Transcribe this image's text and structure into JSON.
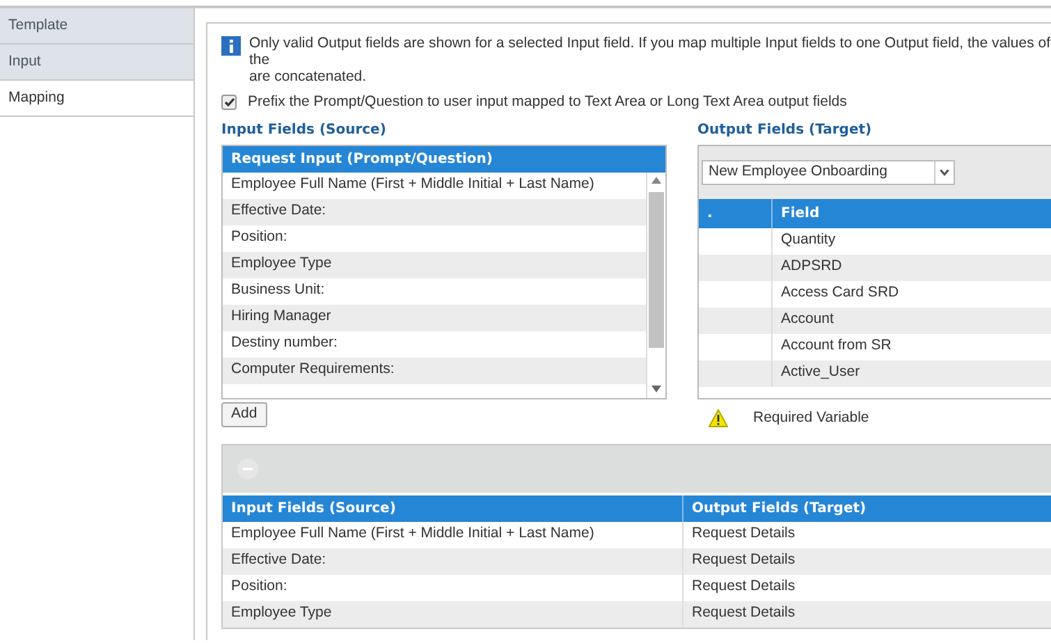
{
  "sidebar": {
    "items": [
      {
        "label": "Template",
        "selected": false
      },
      {
        "label": "Input",
        "selected": false
      },
      {
        "label": "Mapping",
        "selected": true
      }
    ]
  },
  "info": {
    "lines": [
      "Only valid Output fields are shown for a selected Input field. If you map multiple Input fields to one Output field, the values of the",
      "are concatenated."
    ]
  },
  "prefix_option": {
    "label": "Prefix the Prompt/Question to user input mapped to Text Area or Long Text Area output fields",
    "checked": true
  },
  "input_fields": {
    "title": "Input Fields (Source)",
    "column": "Request Input (Prompt/Question)",
    "rows": [
      "Employee Full Name (First + Middle Initial + Last Name)",
      "Effective Date:",
      "Position:",
      "Employee Type",
      "Business Unit:",
      "Hiring Manager",
      "Destiny number:",
      "Computer Requirements:"
    ],
    "button": "Add"
  },
  "output_fields": {
    "title": "Output Fields (Target)",
    "dropdown": "New Employee Onboarding",
    "columns": [
      ".",
      "Field"
    ],
    "rows": [
      "Quantity",
      "ADPSRD",
      "Access Card SRD",
      "Account",
      "Account from SR",
      "Active_User"
    ],
    "legend": "Required Variable"
  },
  "mappings": {
    "columns": [
      "Input Fields (Source)",
      "Output Fields (Target)"
    ],
    "rows": [
      {
        "source": "Employee Full Name (First + Middle Initial + Last Name)",
        "target": "Request Details"
      },
      {
        "source": "Effective Date:",
        "target": "Request Details"
      },
      {
        "source": "Position:",
        "target": "Request Details"
      },
      {
        "source": "Employee Type",
        "target": "Request Details"
      }
    ]
  }
}
